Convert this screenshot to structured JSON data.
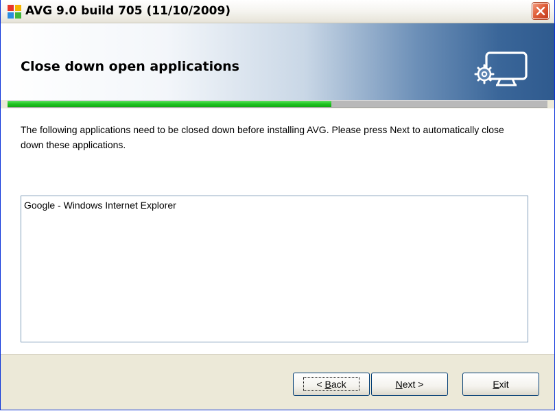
{
  "window": {
    "title": "AVG 9.0 build 705 (11/10/2009)"
  },
  "banner": {
    "title": "Close down open applications",
    "icon": "monitor-gear-icon"
  },
  "progress": {
    "percent": 60,
    "color": "#1fc41f"
  },
  "body": {
    "instruction": "The following applications need to be closed down before installing AVG. Please press Next to automatically close down these applications.",
    "applications": [
      "Google - Windows Internet Explorer"
    ]
  },
  "buttons": {
    "back": {
      "prefix": "< ",
      "accel": "B",
      "rest": "ack"
    },
    "next": {
      "prefix": "",
      "accel": "N",
      "rest": "ext >"
    },
    "exit": {
      "prefix": "",
      "accel": "E",
      "rest": "xit"
    }
  },
  "colors": {
    "close_button": "#e05f3a",
    "banner_accent": "#2f5a8e"
  }
}
